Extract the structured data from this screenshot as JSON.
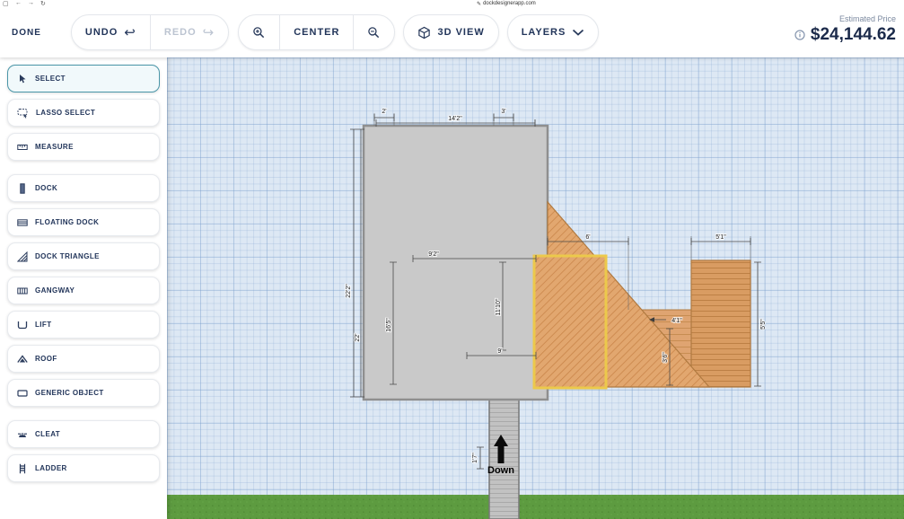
{
  "chrome": {
    "window_icon": "▢",
    "back": "←",
    "forward": "→",
    "refresh": "↻",
    "edit_icon": "✎",
    "url": "dockdesignerapp.com"
  },
  "toolbar": {
    "done": "DONE",
    "undo": "UNDO",
    "undo_icon": "↩",
    "redo": "REDO",
    "redo_icon": "↪",
    "center": "CENTER",
    "view3d": "3D VIEW",
    "layers": "LAYERS",
    "estimated_price_label": "Estimated Price",
    "estimated_price": "$24,144.62"
  },
  "sidebar": {
    "items": [
      {
        "label": "SELECT",
        "icon": "cursor-icon",
        "selected": true
      },
      {
        "label": "LASSO SELECT",
        "icon": "lasso-icon",
        "selected": false
      },
      {
        "label": "MEASURE",
        "icon": "ruler-icon",
        "selected": false
      },
      {
        "label": "DOCK",
        "icon": "dock-icon",
        "selected": false
      },
      {
        "label": "FLOATING DOCK",
        "icon": "floating-dock-icon",
        "selected": false
      },
      {
        "label": "DOCK TRIANGLE",
        "icon": "dock-triangle-icon",
        "selected": false
      },
      {
        "label": "GANGWAY",
        "icon": "gangway-icon",
        "selected": false
      },
      {
        "label": "LIFT",
        "icon": "lift-icon",
        "selected": false
      },
      {
        "label": "ROOF",
        "icon": "roof-icon",
        "selected": false
      },
      {
        "label": "GENERIC OBJECT",
        "icon": "generic-object-icon",
        "selected": false
      },
      {
        "label": "CLEAT",
        "icon": "cleat-icon",
        "selected": false
      },
      {
        "label": "LADDER",
        "icon": "ladder-icon",
        "selected": false
      }
    ]
  },
  "canvas": {
    "down": "Down",
    "dims": [
      "2'",
      "14'2\"",
      "3'",
      "22'2\"",
      "22'",
      "9'2\"",
      "16'5\"",
      "11'10\"",
      "9'",
      "6'",
      "5'1\"",
      "5'5\"",
      "4'1\"",
      "3'6\"",
      "1'7\""
    ]
  },
  "colors": {
    "accent_teal": "#4a96a8",
    "price_navy": "#1b2a4a",
    "wood_orange": "#dfa46f",
    "selection_yellow": "#ecc94b",
    "grass_green": "#5d9b40",
    "grid_blue": "#dde8f4"
  }
}
